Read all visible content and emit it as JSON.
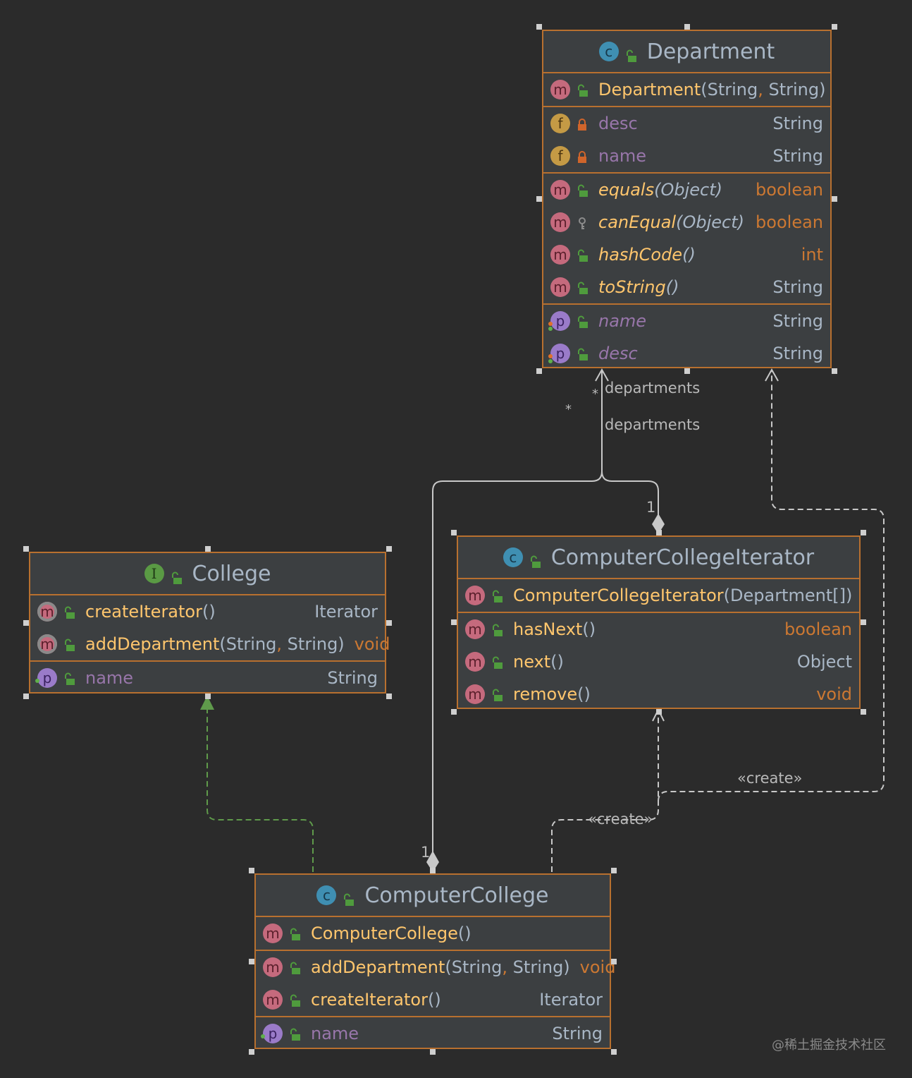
{
  "colors": {
    "background": "#2b2b2b",
    "box": "#3c3f41",
    "border": "#b8702f",
    "method": "#ffc66d",
    "field": "#9876aa",
    "type": "#a9b7c6",
    "keyword": "#cc7832",
    "association": "#c8c8c8",
    "generalization": "#5f9a4b"
  },
  "classes": [
    {
      "id": "department",
      "kind": "c",
      "title": "Department",
      "sections": [
        [
          {
            "kind": "m",
            "vis": "public",
            "name": "Department",
            "params": "(String, String)",
            "type": ""
          }
        ],
        [
          {
            "kind": "f",
            "vis": "private",
            "name": "desc",
            "params": "",
            "type": "String",
            "field": true
          },
          {
            "kind": "f",
            "vis": "private",
            "name": "name",
            "params": "",
            "type": "String",
            "field": true
          }
        ],
        [
          {
            "kind": "m",
            "vis": "public",
            "name": "equals",
            "params": "(Object)",
            "type": "boolean",
            "kw": true,
            "italic": true
          },
          {
            "kind": "m",
            "vis": "protected",
            "name": "canEqual",
            "params": "(Object)",
            "type": "boolean",
            "kw": true,
            "italic": true
          },
          {
            "kind": "m",
            "vis": "public",
            "name": "hashCode",
            "params": "()",
            "type": "int",
            "kw": true,
            "italic": true
          },
          {
            "kind": "m",
            "vis": "public",
            "name": "toString",
            "params": "()",
            "type": "String",
            "italic": true
          }
        ],
        [
          {
            "kind": "p",
            "vis": "public",
            "name": "name",
            "params": "",
            "type": "String",
            "field": true,
            "italic": true,
            "dots": [
              "#e0702a",
              "#5fb04a"
            ]
          },
          {
            "kind": "p",
            "vis": "public",
            "name": "desc",
            "params": "",
            "type": "String",
            "field": true,
            "italic": true,
            "dots": [
              "#e0702a",
              "#5fb04a"
            ]
          }
        ]
      ]
    },
    {
      "id": "college",
      "kind": "i",
      "title": "College",
      "sections": [
        [
          {
            "kind": "m",
            "vis": "public",
            "name": "createIterator",
            "params": " ()",
            "type": "Iterator",
            "abstract": true
          },
          {
            "kind": "m",
            "vis": "public",
            "name": "addDepartment",
            "params": " (String, String)",
            "type": "void",
            "kw": true,
            "abstract": true
          }
        ],
        [
          {
            "kind": "p",
            "vis": "public",
            "name": "name",
            "params": "",
            "type": "String",
            "field": true,
            "dots": [
              "#5fb04a"
            ]
          }
        ]
      ]
    },
    {
      "id": "computer-college-iterator",
      "kind": "c",
      "title": "ComputerCollegeIterator",
      "sections": [
        [
          {
            "kind": "m",
            "vis": "public",
            "name": "ComputerCollegeIterator",
            "params": " (Department[])",
            "type": ""
          }
        ],
        [
          {
            "kind": "m",
            "vis": "public",
            "name": "hasNext",
            "params": "()",
            "type": "boolean",
            "kw": true
          },
          {
            "kind": "m",
            "vis": "public",
            "name": "next",
            "params": "()",
            "type": "Object"
          },
          {
            "kind": "m",
            "vis": "public",
            "name": "remove",
            "params": " ()",
            "type": "void",
            "kw": true
          }
        ]
      ]
    },
    {
      "id": "computer-college",
      "kind": "c",
      "title": "ComputerCollege",
      "sections": [
        [
          {
            "kind": "m",
            "vis": "public",
            "name": "ComputerCollege",
            "params": " ()",
            "type": ""
          }
        ],
        [
          {
            "kind": "m",
            "vis": "public",
            "name": "addDepartment",
            "params": " (String, String)",
            "type": "void",
            "kw": true
          },
          {
            "kind": "m",
            "vis": "public",
            "name": "createIterator",
            "params": " ()",
            "type": "Iterator"
          }
        ],
        [
          {
            "kind": "p",
            "vis": "public",
            "name": "name",
            "params": "",
            "type": "String",
            "field": true,
            "dots": [
              "#5fb04a"
            ]
          }
        ]
      ]
    }
  ],
  "labels": {
    "departments_1": "departments",
    "departments_2": "departments",
    "star_1": "*",
    "star_2": "*",
    "one_1": "1",
    "one_2": "1",
    "create_1": "«create»",
    "create_2": "«create»"
  },
  "watermark": "@稀土掘金技术社区"
}
